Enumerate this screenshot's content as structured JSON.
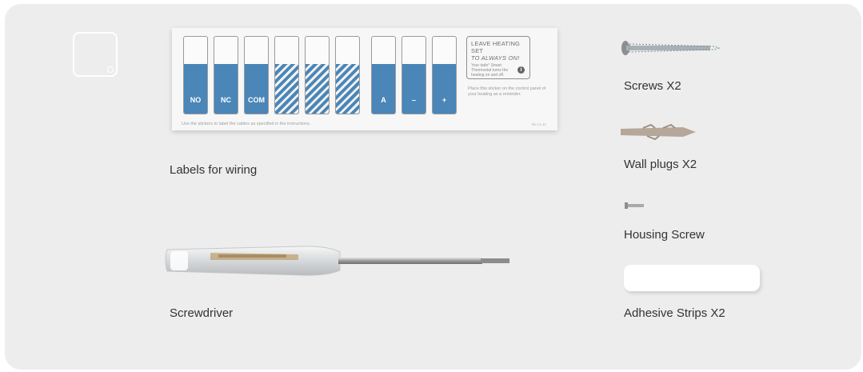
{
  "wiring_sticker": {
    "terminals": [
      "NO",
      "NC",
      "COM",
      "",
      "",
      "",
      "A",
      "–",
      "+"
    ],
    "heating_note_title_line1": "LEAVE HEATING SET",
    "heating_note_title_line2": "TO ALWAYS ON!",
    "heating_note_body": "Your tado° Smart Thermostat turns the heating on and off.",
    "place_text": "Place this sticker on the control panel of your heating as a reminder.",
    "footer": "Use the stickers to label the cables as specified in the instructions.",
    "code": "Rv-L1.41"
  },
  "items": {
    "labels_caption": "Labels for wiring",
    "screwdriver_caption": "Screwdriver",
    "screws_caption": "Screws X2",
    "wall_plugs_caption": "Wall plugs X2",
    "housing_screw_caption": "Housing Screw",
    "adhesive_caption": "Adhesive Strips X2"
  },
  "icons": {
    "device": "thermostat-outline-icon",
    "info": "info-icon"
  },
  "colors": {
    "panel_bg": "#ededed",
    "sticker_blue": "#4a86b8",
    "text": "#333333"
  }
}
